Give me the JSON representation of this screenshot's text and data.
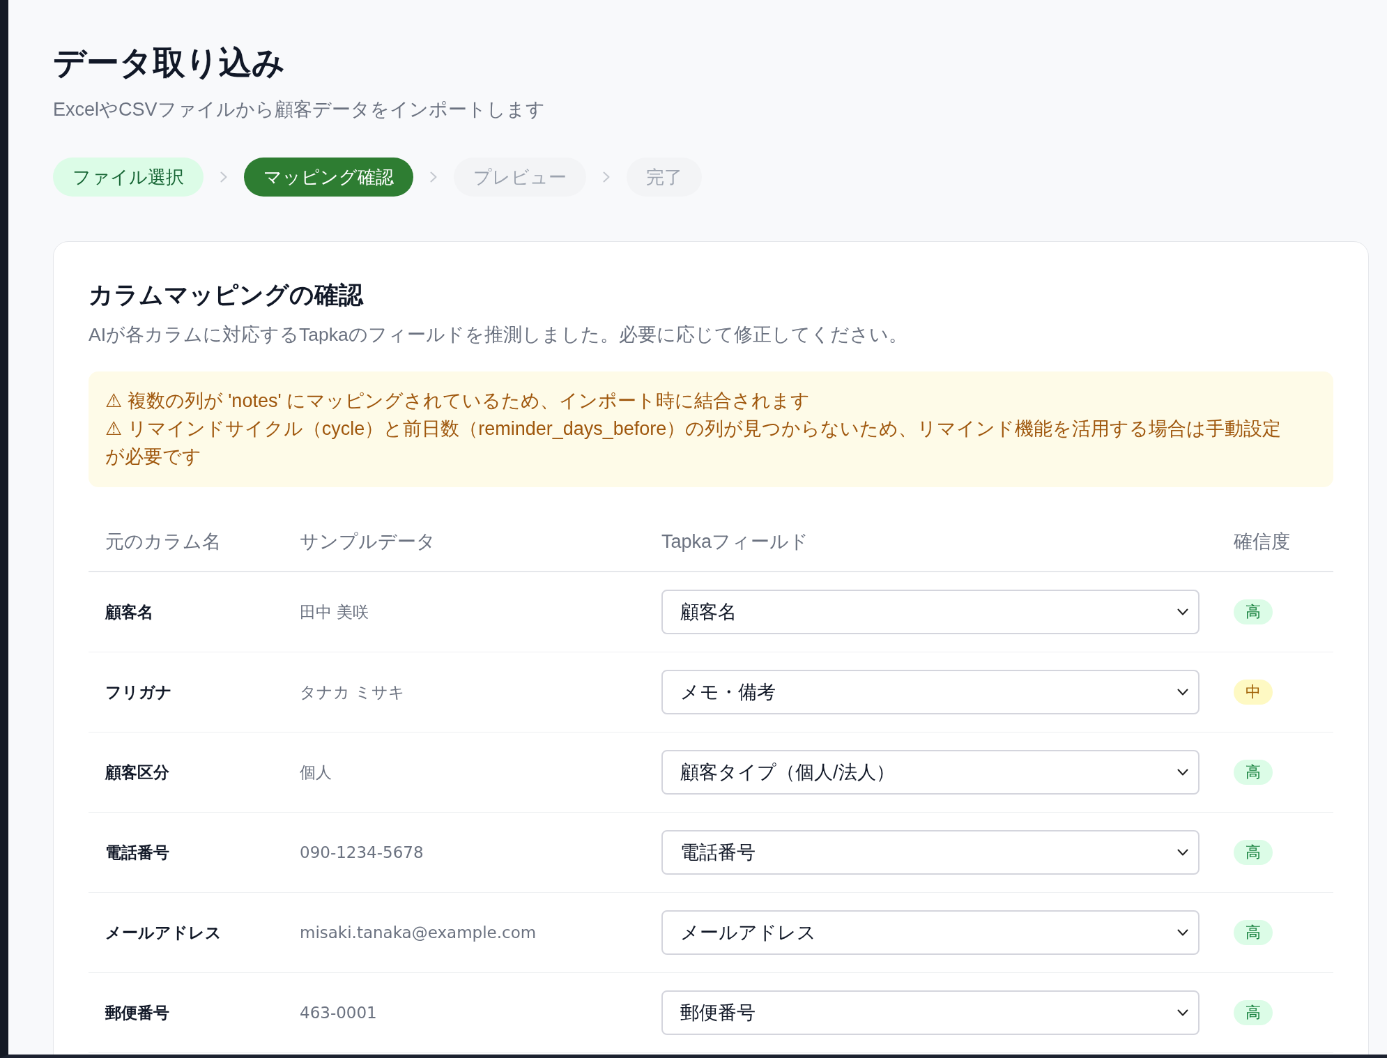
{
  "page": {
    "title": "データ取り込み",
    "subtitle": "ExcelやCSVファイルから顧客データをインポートします"
  },
  "steps": [
    {
      "label": "ファイル選択",
      "completed": true,
      "selected": false
    },
    {
      "label": "マッピング確認",
      "completed": false,
      "selected": true
    },
    {
      "label": "プレビュー",
      "completed": false,
      "selected": false
    },
    {
      "label": "完了",
      "completed": false,
      "selected": false
    }
  ],
  "card": {
    "title": "カラムマッピングの確認",
    "description": "AIが各カラムに対応するTapkaのフィールドを推測しました。必要に応じて修正してください。",
    "warnings": [
      "⚠ 複数の列が 'notes' にマッピングされているため、インポート時に結合されます",
      "⚠ リマインドサイクル（cycle）と前日数（reminder_days_before）の列が見つからないため、リマインド機能を活用する場合は手動設定が必要です"
    ],
    "table": {
      "columns": [
        "元のカラム名",
        "サンプルデータ",
        "Tapkaフィールド",
        "確信度"
      ],
      "rows": [
        {
          "source_column": "顧客名",
          "sample": "田中 美咲",
          "field": "顧客名",
          "confidence": {
            "label": "高",
            "kind": "high"
          }
        },
        {
          "source_column": "フリガナ",
          "sample": "タナカ ミサキ",
          "field": "メモ・備考",
          "confidence": {
            "label": "中",
            "kind": "medium"
          }
        },
        {
          "source_column": "顧客区分",
          "sample": "個人",
          "field": "顧客タイプ（個人/法人）",
          "confidence": {
            "label": "高",
            "kind": "high"
          }
        },
        {
          "source_column": "電話番号",
          "sample": "090-1234-5678",
          "field": "電話番号",
          "confidence": {
            "label": "高",
            "kind": "high"
          }
        },
        {
          "source_column": "メールアドレス",
          "sample": "misaki.tanaka@example.com",
          "field": "メールアドレス",
          "confidence": {
            "label": "高",
            "kind": "high"
          }
        },
        {
          "source_column": "郵便番号",
          "sample": "463-0001",
          "field": "郵便番号",
          "confidence": {
            "label": "高",
            "kind": "high"
          }
        }
      ]
    }
  }
}
